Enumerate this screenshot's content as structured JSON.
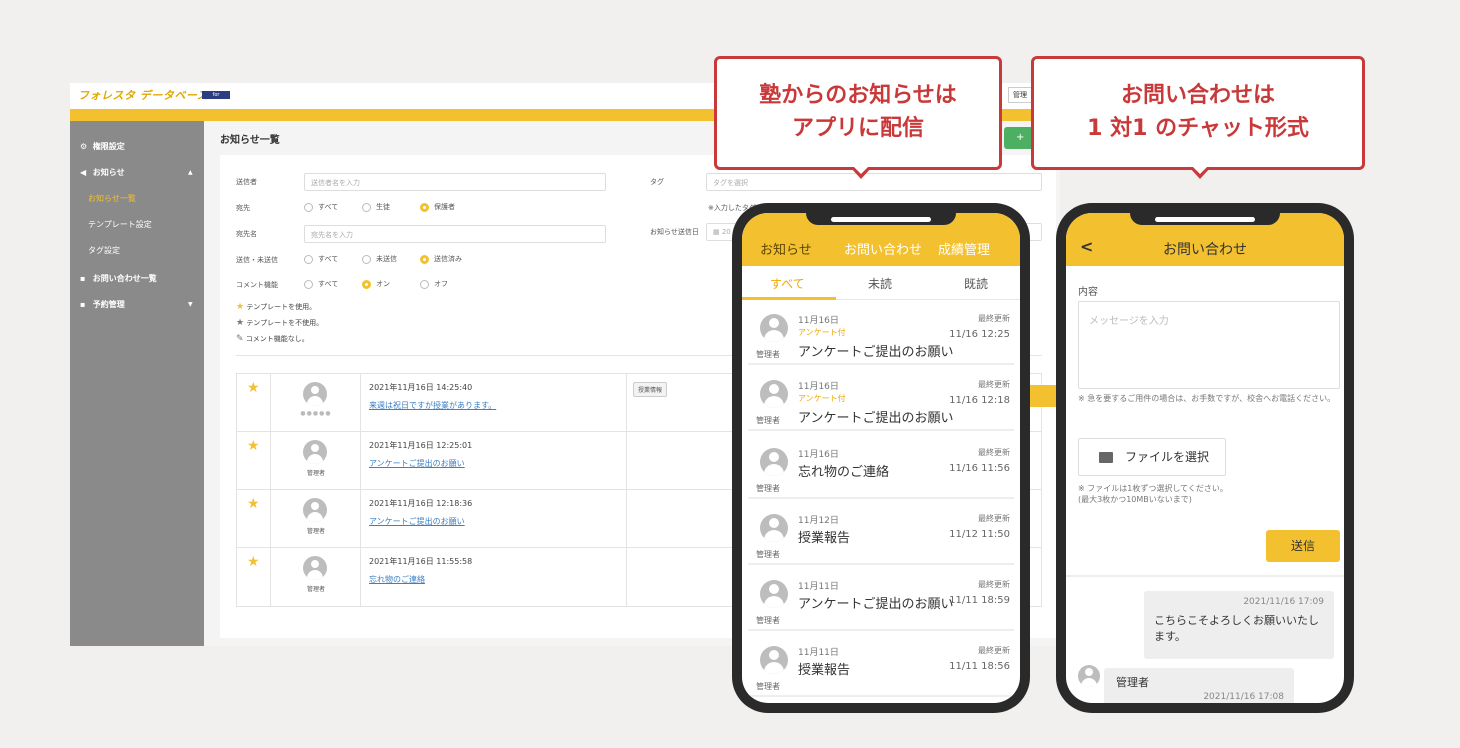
{
  "admin": {
    "logo": "フォレスタ データベース",
    "logo_badge": "for SCHOOL",
    "user_button": "管理",
    "page_title": "お知らせ一覧",
    "create_button_icon": "+",
    "sidebar": {
      "items": [
        {
          "label": "権限設定",
          "icon": "gear-icon"
        },
        {
          "label": "お知らせ",
          "icon": "megaphone-icon"
        },
        {
          "label": "お問い合わせ一覧",
          "icon": "phone-icon"
        },
        {
          "label": "予約管理",
          "icon": "document-icon"
        }
      ],
      "sub_items": [
        "お知らせ一覧",
        "テンプレート設定",
        "タグ設定"
      ],
      "expand_icon": "▲",
      "collapse_icon": "▼"
    },
    "filters": {
      "sender_label": "送信者",
      "sender_placeholder": "送信者名を入力",
      "tag_label": "タグ",
      "tag_placeholder": "タグを選択",
      "tag_hint": "※入力したタグ",
      "destination_label": "宛先",
      "destination_options": [
        "すべて",
        "生徒",
        "保護者"
      ],
      "destination_name_label": "宛先名",
      "destination_name_placeholder": "宛先名を入力",
      "sent_date_label": "お知らせ送信日",
      "sent_date_value": "20",
      "status_label": "送信・未送信",
      "status_options": [
        "すべて",
        "未送信",
        "送信済み"
      ],
      "comment_label": "コメント機能",
      "comment_options": [
        "すべて",
        "オン",
        "オフ"
      ]
    },
    "legend": [
      "テンプレートを使用。",
      "テンプレートを不使用。",
      "コメント機能なし。"
    ],
    "notices": [
      {
        "datetime": "2021年11月16日 14:25:40",
        "title": "来週は祝日ですが授業があります。",
        "sender": "●●●●●",
        "tag": "授業情報"
      },
      {
        "datetime": "2021年11月16日 12:25:01",
        "title": "アンケートご提出のお願い",
        "sender": "管理者",
        "tag": ""
      },
      {
        "datetime": "2021年11月16日 12:18:36",
        "title": "アンケートご提出のお願い",
        "sender": "管理者",
        "tag": ""
      },
      {
        "datetime": "2021年11月16日 11:55:58",
        "title": "忘れ物のご連絡",
        "sender": "管理者",
        "tag": ""
      }
    ]
  },
  "callouts": {
    "left": [
      "塾からのお知らせは",
      "アプリに配信"
    ],
    "right": [
      "お問い合わせは",
      "1 対1 のチャット形式"
    ]
  },
  "phone1": {
    "tabs": [
      "お知らせ",
      "お問い合わせ",
      "成績管理"
    ],
    "subtabs": [
      "すべて",
      "未読",
      "既読"
    ],
    "updated_label": "最終更新",
    "messages": [
      {
        "date": "11月16日",
        "badge": "アンケート付",
        "title": "アンケートご提出のお願い",
        "updated": "11/16 12:25",
        "who": "管理者"
      },
      {
        "date": "11月16日",
        "badge": "アンケート付",
        "title": "アンケートご提出のお願い",
        "updated": "11/16 12:18",
        "who": "管理者"
      },
      {
        "date": "11月16日",
        "badge": "",
        "title": "忘れ物のご連絡",
        "updated": "11/16 11:56",
        "who": "管理者"
      },
      {
        "date": "11月12日",
        "badge": "",
        "title": "授業報告",
        "updated": "11/12 11:50",
        "who": "管理者"
      },
      {
        "date": "11月11日",
        "badge": "",
        "title": "アンケートご提出のお願い",
        "updated": "11/11 18:59",
        "who": "管理者"
      },
      {
        "date": "11月11日",
        "badge": "",
        "title": "授業報告",
        "updated": "11/11 18:56",
        "who": "管理者"
      }
    ]
  },
  "phone2": {
    "back": "<",
    "title": "お問い合わせ",
    "content_label": "内容",
    "placeholder": "メッセージを入力",
    "urgent_note": "※ 急を要するご用件の場合は、お手数ですが、校舎へお電話ください。",
    "file_button": "ファイルを選択",
    "file_note_1": "※ ファイルは1枚ずつ選択してください。",
    "file_note_2": "(最大3枚かつ10MBいないまで)",
    "send_button": "送信",
    "chat": [
      {
        "time": "2021/11/16 17:09",
        "text": "こちらこそよろしくお願いいたします。"
      },
      {
        "name": "管理者",
        "time": "2021/11/16 17:08"
      }
    ]
  },
  "colors": {
    "accent": "#f3c12f",
    "callout": "#c9393a",
    "link": "#3b7fc4",
    "green": "#4caf62"
  }
}
